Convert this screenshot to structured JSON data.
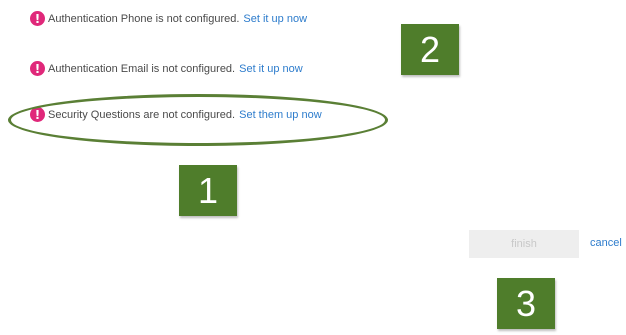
{
  "status_messages": [
    {
      "text": "Authentication Phone is not configured.",
      "link": "Set it up now"
    },
    {
      "text": "Authentication Email is not configured.",
      "link": "Set it up now"
    },
    {
      "text": "Security Questions are not configured.",
      "link": "Set them up now"
    }
  ],
  "callouts": [
    "1",
    "2",
    "3"
  ],
  "actions": {
    "finish_label": "finish",
    "cancel_label": "cancel"
  },
  "icons": {
    "warning": "exclamation-circle-icon",
    "warning_glyph": "!"
  },
  "colors": {
    "warning_icon": "#e0287a",
    "link": "#2d7ccc",
    "callout_bg": "#4f7d2b",
    "highlight_ring": "#5a7f35",
    "finish_button_bg": "#eeeeee",
    "finish_button_text": "#c8c8c8"
  }
}
